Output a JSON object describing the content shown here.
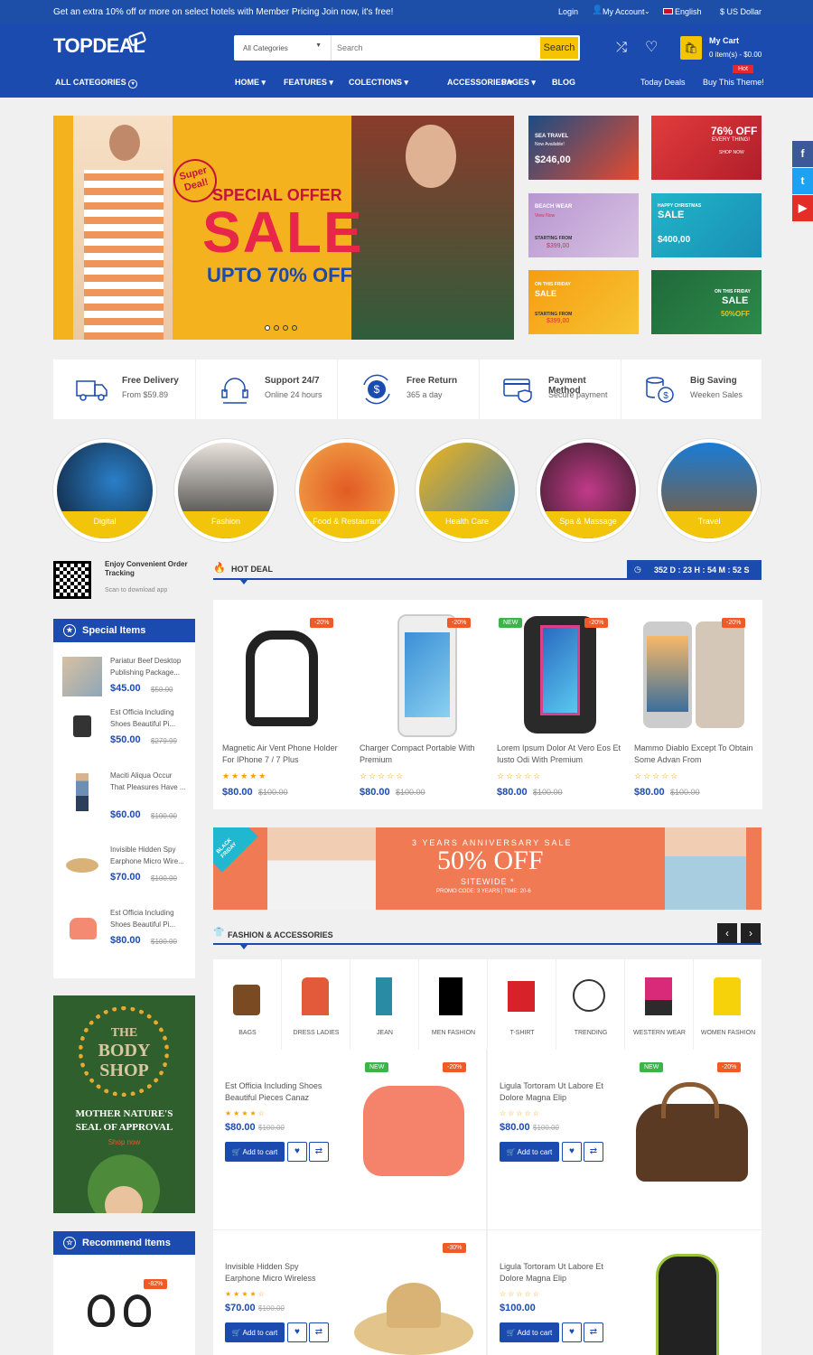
{
  "topbar": {
    "promo": "Get an extra 10% off or more on select hotels with Member Pricing Join now, it's free!",
    "login": "Login",
    "account": "My Account",
    "language": "English",
    "currency": "US Dollar"
  },
  "header": {
    "logo": "TOPDEAL",
    "search": {
      "category": "All Categories",
      "placeholder": "Search",
      "button": "Search"
    },
    "cart": {
      "title": "My Cart",
      "summary": "0 item(s) - $0.00"
    }
  },
  "nav": {
    "all_categories": "ALL CATEGORIES",
    "items": [
      "HOME",
      "FEATURES",
      "COLECTIONS",
      "ACCESSORIES",
      "PAGES",
      "BLOG"
    ],
    "today_deals": "Today Deals",
    "buy_theme": "Buy This Theme!",
    "hot_badge": "Hot"
  },
  "hero": {
    "badge": "Super Deal!",
    "line1": "SPECIAL OFFER",
    "line2": "SALE",
    "line3": "UPTO 70% OFF"
  },
  "tiles": [
    {
      "l1": "SEA TRAVEL",
      "l2": "Now Available!",
      "price": "$246,00"
    },
    {
      "l1": "76% OFF",
      "l2": "EVERY THING!",
      "l3": "SHOP NOW"
    },
    {
      "l1": "BEACH WEAR",
      "l2": "View Now",
      "l3": "STARTING FROM",
      "price": "$399,00"
    },
    {
      "l1": "HAPPY CHRISTMAS",
      "l2": "SALE",
      "price": "$400,00"
    },
    {
      "l1": "ON THIS FRIDAY",
      "l2": "SALE",
      "l3": "STARTING FROM",
      "price": "$399,00"
    },
    {
      "l1": "ON THIS FRIDAY",
      "l2": "SALE",
      "price": "50%OFF"
    }
  ],
  "features": [
    {
      "title": "Free Delivery",
      "sub": "From $59.89"
    },
    {
      "title": "Support 24/7",
      "sub": "Online 24 hours"
    },
    {
      "title": "Free Return",
      "sub": "365 a day"
    },
    {
      "title": "Payment Method",
      "sub": "Secure payment"
    },
    {
      "title": "Big Saving",
      "sub": "Weeken Sales"
    }
  ],
  "circles": [
    "Digital",
    "Fashion",
    "Food & Restaurant",
    "Health Care",
    "Spa & Massage",
    "Travel"
  ],
  "qr": {
    "title": "Enjoy Convenient Order Tracking",
    "sub": "Scan to download app"
  },
  "special": {
    "title": "Special Items",
    "items": [
      {
        "name": "Pariatur Beef Desktop Publishing Package...",
        "price": "$45.00",
        "old": "$50.00"
      },
      {
        "name": "Est Officia Including Shoes Beautiful Pi...",
        "price": "$50.00",
        "old": "$279.99"
      },
      {
        "name": "Maciti Aliqua Occur That Pleasures Have ...",
        "price": "$60.00",
        "old": "$100.00"
      },
      {
        "name": "Invisible Hidden Spy Earphone Micro Wire...",
        "price": "$70.00",
        "old": "$100.00"
      },
      {
        "name": "Est Officia Including Shoes Beautiful Pi...",
        "price": "$80.00",
        "old": "$100.00"
      }
    ]
  },
  "hotdeal": {
    "title": "HOT DEAL",
    "countdown": "352 D : 23 H : 54 M : 52 S",
    "products": [
      {
        "name": "Magnetic Air Vent Phone Holder For IPhone 7 / 7 Plus",
        "price": "$80.00",
        "old": "$100.00",
        "badge": "-20%",
        "new": ""
      },
      {
        "name": "Charger Compact Portable With Premium",
        "price": "$80.00",
        "old": "$100.00",
        "badge": "-20%",
        "new": ""
      },
      {
        "name": "Lorem Ipsum Dolor At Vero Eos Et Iusto Odi With Premium",
        "price": "$80.00",
        "old": "$100.00",
        "badge": "-20%",
        "new": "NEW"
      },
      {
        "name": "Mammo Diablo Except To Obtain Some Advan From",
        "price": "$80.00",
        "old": "$100.00",
        "badge": "-20%",
        "new": ""
      }
    ]
  },
  "anniv": {
    "corner": "BLACK FRIDAY",
    "l1": "3 YEARS ANNIVERSARY SALE",
    "l2": "50% OFF",
    "l3": "SITEWIDE *",
    "l4": "PROMO CODE: 3 YEARS | TIME: 20-6"
  },
  "fashion": {
    "title": "FASHION & ACCESSORIES",
    "categories": [
      "BAGS",
      "DRESS LADIES",
      "JEAN",
      "MEN FASHION",
      "T-SHIRT",
      "TRENDING",
      "WESTERN WEAR",
      "WOMEN FASHION"
    ],
    "add_to_cart": "Add to cart",
    "products": [
      {
        "name": "Est Officia Including Shoes Beautiful Pieces Canaz",
        "price": "$80.00",
        "old": "$100.00",
        "badge": "-20%",
        "new": "NEW"
      },
      {
        "name": "Ligula Tortoram Ut Labore Et Dolore Magna Elip",
        "price": "$80.00",
        "old": "$100.00",
        "badge": "-20%",
        "new": "NEW"
      },
      {
        "name": "Invisible Hidden Spy Earphone Micro Wireless",
        "price": "$70.00",
        "old": "$100.00",
        "badge": "-30%",
        "new": ""
      },
      {
        "name": "Ligula Tortoram Ut Labore Et Dolore Magna Elip",
        "price": "$100.00",
        "old": "",
        "badge": "",
        "new": ""
      }
    ]
  },
  "bodyshop": {
    "l1": "THE",
    "l2": "BODY",
    "l3": "SHOP",
    "l4": "MOTHER NATURE'S",
    "l5": "SEAL OF APPROVAL",
    "l6": "Shop now"
  },
  "recommend": {
    "title": "Recommend Items",
    "badge": "-82%"
  },
  "colors": {
    "primary": "#1c4bb0",
    "accent": "#f5c400",
    "sale": "#f15a24",
    "new": "#3bb54a"
  }
}
